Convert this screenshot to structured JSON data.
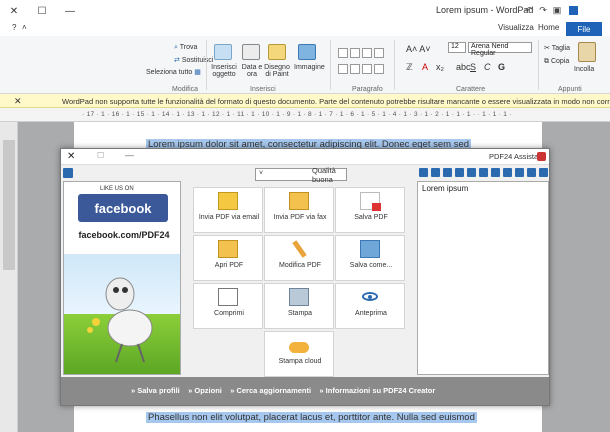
{
  "window": {
    "title": "Lorem ipsum - WordPad"
  },
  "tabs": {
    "file": "File",
    "home": "Home",
    "view": "Visualizza"
  },
  "ribbon": {
    "clipboard": {
      "group": "Appunti",
      "paste": "Incolla",
      "cut": "Taglia",
      "copy": "Copia"
    },
    "font": {
      "group": "Carattere",
      "font_name": "Arena Nend Regular",
      "font_size": "12"
    },
    "paragraph": {
      "group": "Paragrafo"
    },
    "insert": {
      "group": "Inserisci",
      "image": "Immagine",
      "paint": "Disegno di Paint",
      "datetime": "Data e ora",
      "object": "Inserisci oggetto"
    },
    "edit": {
      "group": "Modifica",
      "find": "Trova",
      "replace": "Sostituisci",
      "select_all": "Seleziona tutto"
    }
  },
  "infobar": {
    "message": "WordPad non supporta tutte le funzionalità del formato di questo documento. Parte del contenuto potrebbe risultare mancante o essere visualizzata in modo non corretto."
  },
  "ruler": {
    "text": "· 17 · 1 · 16 · 1 · 15 · 1 · 14 · 1 · 13 · 1 · 12 · 1 · 11 · 1 · 10 · 1 · 9 · 1 · 8 · 1 · 7 · 1 · 6 · 1 · 5 · 1 · 4 · 1 · 3 · 1 · 2 · 1 · 1 · 1 · · 1 · 1 · 1 ·"
  },
  "document": {
    "line1": "Lorem ipsum dolor sit amet, consectetur adipiscing elit. Donec eget sem sed",
    "line2": "Phasellus non elit volutpat, placerat lacus et, porttitor ante. Nulla sed euismod"
  },
  "dialog": {
    "title": "PDF24 Assistant",
    "quality": "Qualità buona",
    "content_item": "Lorem ipsum",
    "ad": {
      "like": "LIKE US ON",
      "brand": "facebook",
      "url": "facebook.com/PDF24"
    },
    "actions": [
      {
        "label": "Salva PDF",
        "icon": "save-pdf-icon"
      },
      {
        "label": "Invia PDF via fax",
        "icon": "fax-icon"
      },
      {
        "label": "Invia PDF via email",
        "icon": "email-icon"
      },
      {
        "label": "Salva come...",
        "icon": "save-as-icon"
      },
      {
        "label": "Modifica PDF",
        "icon": "pencil-icon"
      },
      {
        "label": "Apri PDF",
        "icon": "folder-icon"
      },
      {
        "label": "Anteprima",
        "icon": "eye-icon"
      },
      {
        "label": "Stampa",
        "icon": "printer-icon"
      },
      {
        "label": "Comprimi",
        "icon": "compress-icon"
      },
      {
        "label": "Stampa cloud",
        "icon": "cloud-icon"
      }
    ],
    "footer": {
      "info": "» Informazioni su PDF24 Creator",
      "updates": "» Cerca aggiornamenti",
      "options": "» Opzioni",
      "profiles": "» Salva profili"
    }
  },
  "colors": {
    "accent": "#1e63b7",
    "highlight": "#a6c7ee",
    "facebook": "#3b5998"
  }
}
